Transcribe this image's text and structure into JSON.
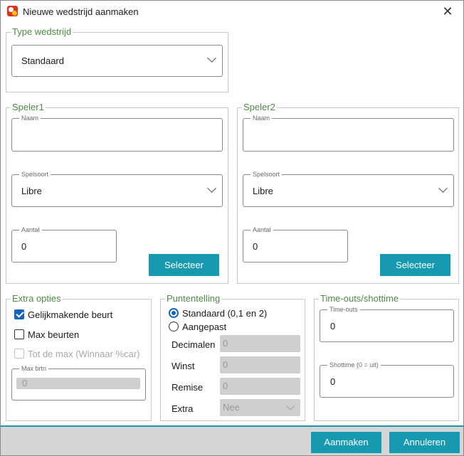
{
  "window": {
    "title": "Nieuwe wedstrijd aanmaken"
  },
  "type_group": {
    "title": "Type wedstrijd",
    "selected": "Standaard"
  },
  "speler1": {
    "title": "Speler1",
    "naam_label": "Naam",
    "naam_value": "",
    "spelsoort_label": "Spelsoort",
    "spelsoort_value": "Libre",
    "aantal_label": "Aantal",
    "aantal_value": "0",
    "select_label": "Selecteer"
  },
  "speler2": {
    "title": "Speler2",
    "naam_label": "Naam",
    "naam_value": "",
    "spelsoort_label": "Spelsoort",
    "spelsoort_value": "Libre",
    "aantal_label": "Aantal",
    "aantal_value": "0",
    "select_label": "Selecteer"
  },
  "extra": {
    "title": "Extra opties",
    "gelijkmakende_label": "Gelijkmakende beurt",
    "gelijkmakende_checked": true,
    "max_beurten_label": "Max beurten",
    "max_beurten_checked": false,
    "tot_de_max_label": "Tot de max (Winnaar %car)",
    "tot_de_max_checked": false,
    "max_brtn_label": "Max brtn",
    "max_brtn_value": "0"
  },
  "punten": {
    "title": "Puntentelling",
    "standaard_label": "Standaard (0,1 en 2)",
    "aangepast_label": "Aangepast",
    "decimalen_label": "Decimalen",
    "decimalen_value": "0",
    "winst_label": "Winst",
    "winst_value": "0",
    "remise_label": "Remise",
    "remise_value": "0",
    "extra_label": "Extra",
    "extra_value": "Nee"
  },
  "timeouts": {
    "title": "Time-outs/shottime",
    "timeouts_label": "Time-outs",
    "timeouts_value": "0",
    "shottime_label": "Shottime (0 = uit)",
    "shottime_value": "0"
  },
  "footer": {
    "create_label": "Aanmaken",
    "cancel_label": "Annuleren"
  },
  "colors": {
    "accent": "#1799b0",
    "group_title": "#4e8a45",
    "check": "#1565c0"
  }
}
